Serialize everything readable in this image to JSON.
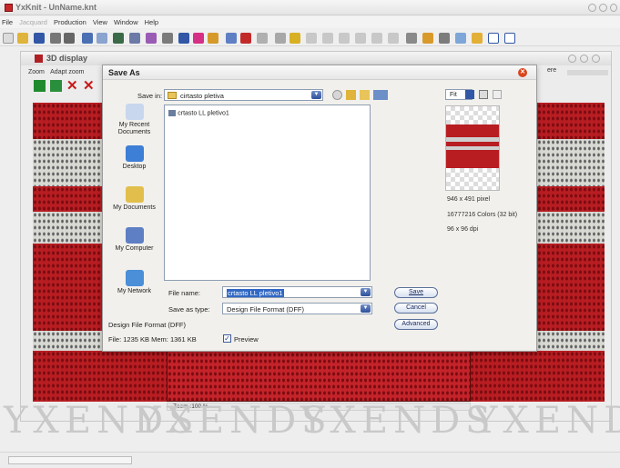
{
  "app": {
    "title": "YxKnit - UnName.knt",
    "menu": [
      {
        "label": "File",
        "enabled": true
      },
      {
        "label": "Jacquard",
        "enabled": false
      },
      {
        "label": "Production",
        "enabled": true
      },
      {
        "label": "View",
        "enabled": true
      },
      {
        "label": "Window",
        "enabled": true
      },
      {
        "label": "Help",
        "enabled": true
      }
    ]
  },
  "display_window": {
    "title": "3D display",
    "menu": [
      "Zoom",
      "Adapt zoom"
    ],
    "right_menu_fragment": "ere",
    "zoom_status": "Zoom :100 %",
    "watermark": "YXENDS"
  },
  "dialog": {
    "title": "Save As",
    "save_in_label": "Save in:",
    "save_in_value": "cirtasto pletiva",
    "places": [
      {
        "label": "My Recent Documents",
        "icon": "recent-documents-icon"
      },
      {
        "label": "Desktop",
        "icon": "desktop-icon"
      },
      {
        "label": "My Documents",
        "icon": "my-documents-icon"
      },
      {
        "label": "My Computer",
        "icon": "my-computer-icon"
      },
      {
        "label": "My Network",
        "icon": "my-network-icon"
      }
    ],
    "files": [
      {
        "name": "crtasto LL pletivo1",
        "icon": "dff-file-icon"
      }
    ],
    "file_name_label": "File name:",
    "file_name_value": "crtasto LL pletivo1",
    "save_as_type_label": "Save as type:",
    "save_as_type_value": "Design File Format (DFF)",
    "buttons": {
      "save": "Save",
      "cancel": "Cancel",
      "advanced": "Advanced"
    },
    "format_label": "Design File Format (DFF)",
    "file_info": "File: 1235 KB   Mem: 1361 KB",
    "preview_checkbox_label": "Preview",
    "preview_checked": true,
    "view_menu_label": "Fit",
    "image_info": {
      "size": "946 x 491 pixel",
      "colors": "16777216 Colors (32 bit)",
      "dpi": "96 x 96 dpi"
    }
  },
  "colors": {
    "knit_red": "#b81d22",
    "knit_white": "#d9d9d4",
    "accent_blue": "#2d4f9a"
  }
}
